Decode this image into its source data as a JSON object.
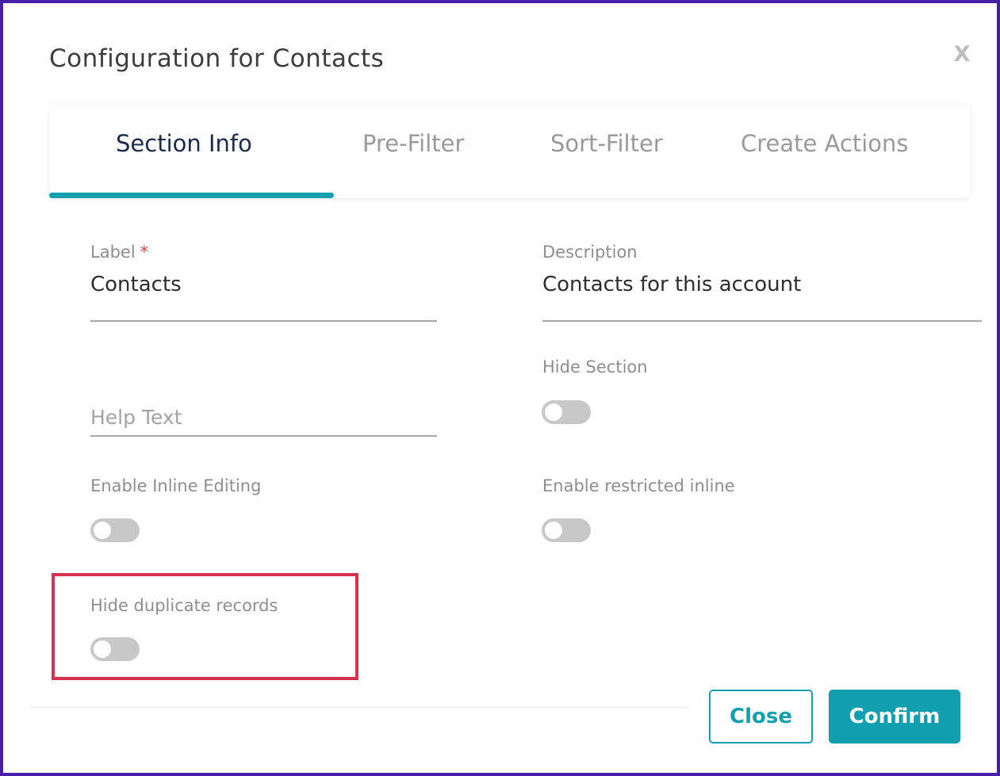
{
  "modal": {
    "title": "Configuration for Contacts",
    "close_glyph": "X"
  },
  "tabs": [
    {
      "label": "Section Info",
      "active": true
    },
    {
      "label": "Pre-Filter",
      "active": false
    },
    {
      "label": "Sort-Filter",
      "active": false
    },
    {
      "label": "Create Actions",
      "active": false
    }
  ],
  "form": {
    "label": {
      "label": "Label",
      "required_mark": "*",
      "value": "Contacts"
    },
    "description": {
      "label": "Description",
      "value": "Contacts for this account"
    },
    "help_text": {
      "placeholder": "Help Text",
      "value": ""
    },
    "hide_section": {
      "label": "Hide Section",
      "on": false
    },
    "enable_inline_editing": {
      "label": "Enable Inline Editing",
      "on": false
    },
    "enable_restricted_inline": {
      "label": "Enable restricted inline",
      "on": false
    },
    "hide_duplicate_records": {
      "label": "Hide duplicate records",
      "on": false
    }
  },
  "buttons": {
    "close_label": "Close",
    "confirm_label": "Confirm"
  },
  "colors": {
    "accent": "#12a0b0",
    "frame_border": "#4a1fa8",
    "highlight": "#d6324f",
    "required": "#e04040"
  }
}
